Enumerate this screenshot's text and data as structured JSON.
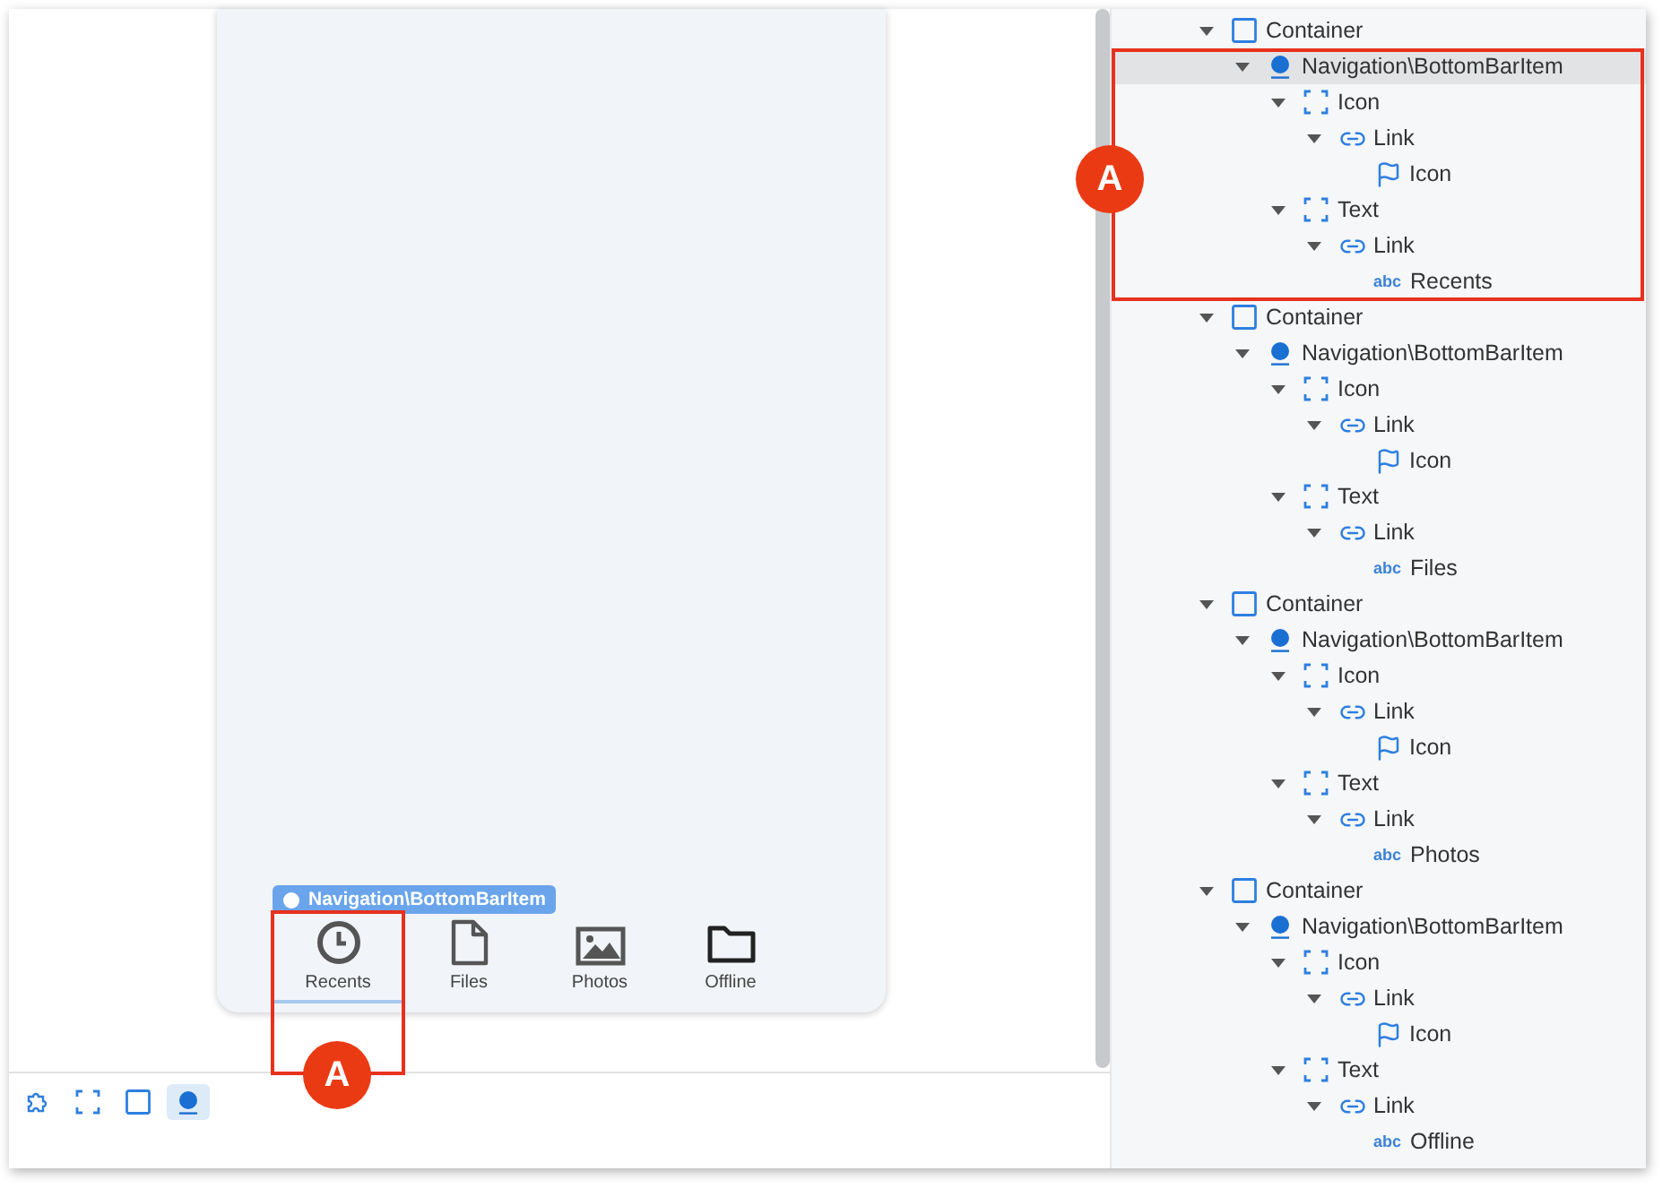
{
  "canvas": {
    "selection_tag": "Navigation\\BottomBarItem",
    "bottom_bar": [
      {
        "label": "Recents",
        "kind": "clock",
        "selected": true
      },
      {
        "label": "Files",
        "kind": "file",
        "selected": false
      },
      {
        "label": "Photos",
        "kind": "image",
        "selected": false
      },
      {
        "label": "Offline",
        "kind": "folder",
        "selected": false
      }
    ]
  },
  "toolbar": [
    {
      "kind": "puzzle",
      "selected": false
    },
    {
      "kind": "bracket",
      "selected": false
    },
    {
      "kind": "square",
      "selected": false
    },
    {
      "kind": "dot",
      "selected": true
    }
  ],
  "tree": [
    {
      "kind": "container",
      "label": "Container",
      "expanded": true,
      "selected": false,
      "children": [
        {
          "kind": "widget",
          "label": "Navigation\\BottomBarItem",
          "expanded": true,
          "selected": true,
          "children": [
            {
              "kind": "group",
              "label": "Icon",
              "expanded": true,
              "selected": false,
              "children": [
                {
                  "kind": "link",
                  "label": "Link",
                  "expanded": true,
                  "selected": false,
                  "children": [
                    {
                      "kind": "image",
                      "label": "Icon",
                      "selected": false
                    }
                  ]
                }
              ]
            },
            {
              "kind": "group",
              "label": "Text",
              "expanded": true,
              "selected": false,
              "children": [
                {
                  "kind": "link",
                  "label": "Link",
                  "expanded": true,
                  "selected": false,
                  "children": [
                    {
                      "kind": "text",
                      "badge": "abc",
                      "label": "Recents",
                      "selected": false
                    }
                  ]
                }
              ]
            }
          ]
        }
      ]
    },
    {
      "kind": "container",
      "label": "Container",
      "expanded": true,
      "selected": false,
      "children": [
        {
          "kind": "widget",
          "label": "Navigation\\BottomBarItem",
          "expanded": true,
          "selected": false,
          "children": [
            {
              "kind": "group",
              "label": "Icon",
              "expanded": true,
              "selected": false,
              "children": [
                {
                  "kind": "link",
                  "label": "Link",
                  "expanded": true,
                  "selected": false,
                  "children": [
                    {
                      "kind": "image",
                      "label": "Icon",
                      "selected": false
                    }
                  ]
                }
              ]
            },
            {
              "kind": "group",
              "label": "Text",
              "expanded": true,
              "selected": false,
              "children": [
                {
                  "kind": "link",
                  "label": "Link",
                  "expanded": true,
                  "selected": false,
                  "children": [
                    {
                      "kind": "text",
                      "badge": "abc",
                      "label": "Files",
                      "selected": false
                    }
                  ]
                }
              ]
            }
          ]
        }
      ]
    },
    {
      "kind": "container",
      "label": "Container",
      "expanded": true,
      "selected": false,
      "children": [
        {
          "kind": "widget",
          "label": "Navigation\\BottomBarItem",
          "expanded": true,
          "selected": false,
          "children": [
            {
              "kind": "group",
              "label": "Icon",
              "expanded": true,
              "selected": false,
              "children": [
                {
                  "kind": "link",
                  "label": "Link",
                  "expanded": true,
                  "selected": false,
                  "children": [
                    {
                      "kind": "image",
                      "label": "Icon",
                      "selected": false
                    }
                  ]
                }
              ]
            },
            {
              "kind": "group",
              "label": "Text",
              "expanded": true,
              "selected": false,
              "children": [
                {
                  "kind": "link",
                  "label": "Link",
                  "expanded": true,
                  "selected": false,
                  "children": [
                    {
                      "kind": "text",
                      "badge": "abc",
                      "label": "Photos",
                      "selected": false
                    }
                  ]
                }
              ]
            }
          ]
        }
      ]
    },
    {
      "kind": "container",
      "label": "Container",
      "expanded": true,
      "selected": false,
      "children": [
        {
          "kind": "widget",
          "label": "Navigation\\BottomBarItem",
          "expanded": true,
          "selected": false,
          "children": [
            {
              "kind": "group",
              "label": "Icon",
              "expanded": true,
              "selected": false,
              "children": [
                {
                  "kind": "link",
                  "label": "Link",
                  "expanded": true,
                  "selected": false,
                  "children": [
                    {
                      "kind": "image",
                      "label": "Icon",
                      "selected": false
                    }
                  ]
                }
              ]
            },
            {
              "kind": "group",
              "label": "Text",
              "expanded": true,
              "selected": false,
              "children": [
                {
                  "kind": "link",
                  "label": "Link",
                  "expanded": true,
                  "selected": false,
                  "children": [
                    {
                      "kind": "text",
                      "badge": "abc",
                      "label": "Offline",
                      "selected": false
                    }
                  ]
                }
              ]
            }
          ]
        }
      ]
    }
  ],
  "callouts": [
    {
      "label": "A"
    },
    {
      "label": "A"
    }
  ]
}
